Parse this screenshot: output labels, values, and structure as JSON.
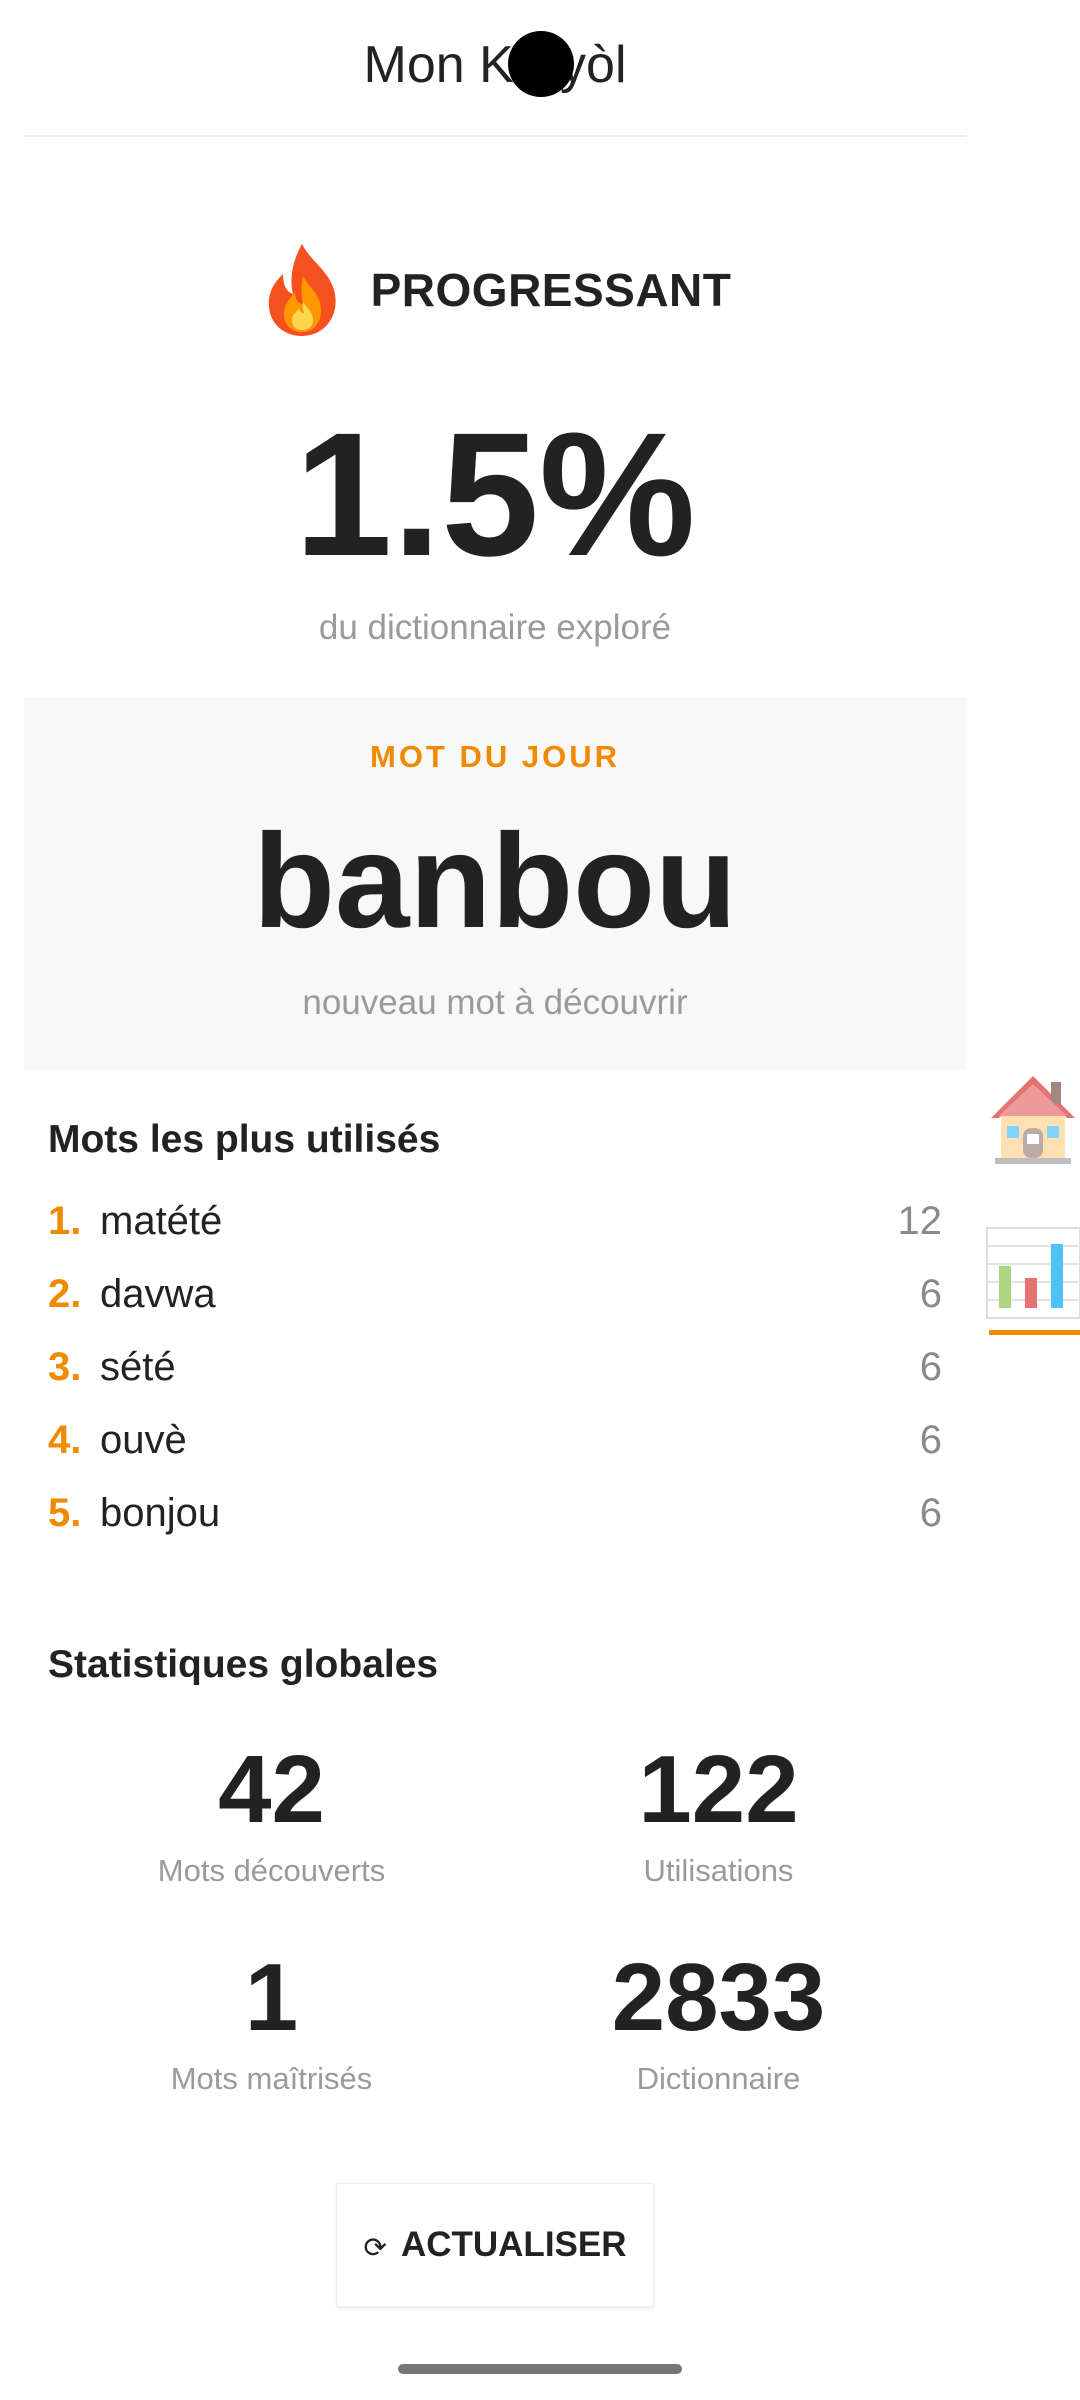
{
  "header": {
    "title": "Mon Kréyòl"
  },
  "level": {
    "icon": "fire-icon",
    "label": "PROGRESSANT"
  },
  "progress": {
    "percent_label": "1.5%",
    "caption": "du dictionnaire exploré"
  },
  "word_of_day": {
    "label": "MOT DU JOUR",
    "word": "banbou",
    "caption": "nouveau mot à découvrir"
  },
  "top_words": {
    "title": "Mots les plus utilisés",
    "items": [
      {
        "rank": "1.",
        "word": "matété",
        "count": "12"
      },
      {
        "rank": "2.",
        "word": "davwa",
        "count": "6"
      },
      {
        "rank": "3.",
        "word": "sété",
        "count": "6"
      },
      {
        "rank": "4.",
        "word": "ouvè",
        "count": "6"
      },
      {
        "rank": "5.",
        "word": "bonjou",
        "count": "6"
      }
    ]
  },
  "global_stats": {
    "title": "Statistiques globales",
    "items": [
      {
        "value": "42",
        "label": "Mots découverts"
      },
      {
        "value": "122",
        "label": "Utilisations"
      },
      {
        "value": "1",
        "label": "Mots maîtrisés"
      },
      {
        "value": "2833",
        "label": "Dictionnaire"
      }
    ]
  },
  "refresh_button": {
    "icon": "refresh-icon",
    "label": "ACTUALISER"
  },
  "side_nav": {
    "items": [
      {
        "icon": "home-icon",
        "active": false
      },
      {
        "icon": "bar-chart-icon",
        "active": true
      }
    ]
  },
  "colors": {
    "accent": "#f08a00",
    "text": "#222222",
    "muted": "#9a9a9a",
    "card_bg": "#f8f8f8"
  }
}
